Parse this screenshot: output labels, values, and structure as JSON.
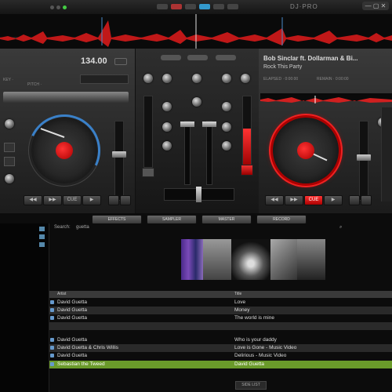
{
  "app": {
    "brand": "DJ·PRO",
    "window_controls": "— ▢ ✕"
  },
  "deckLeft": {
    "bpm": "134.00",
    "sub_label_1": "KEY ·",
    "sub_label_2": "PITCH ·",
    "buttons": [
      "◀◀",
      "▶▶",
      "CUE",
      "▶"
    ]
  },
  "deckRight": {
    "title": "Bob Sinclar ft. Dollarman & Bi...",
    "track": "Rock This Party",
    "info_1": "ELAPSED · 0:00:00",
    "info_2": "REMAIN · 0:00:00",
    "buttons": [
      "◀◀",
      "▶▶",
      "CUE",
      "▶"
    ]
  },
  "tabs": [
    "EFFECTS",
    "SAMPLER",
    "MASTER",
    "RECORD"
  ],
  "browser": {
    "search_label": "Search:",
    "search_value": "guetta",
    "columns": [
      "Artist",
      "Title"
    ],
    "rows": [
      {
        "artist": "David Guetta",
        "title": "Love"
      },
      {
        "artist": "David Guetta",
        "title": "Money"
      },
      {
        "artist": "David Guetta",
        "title": "The world is mine"
      },
      {
        "artist": "",
        "title": ""
      },
      {
        "artist": "David Guetta",
        "title": "Who is your daddy"
      },
      {
        "artist": "David Guetta & Chris Willis",
        "title": "Love is Gone - Music Video"
      },
      {
        "artist": "David Guetta",
        "title": "Delirious - Music Video"
      },
      {
        "artist": "Sebastian the Tweed",
        "title": "David Guetta"
      }
    ],
    "status_button": "SIDE LIST"
  },
  "colors": {
    "accent": "#e02020",
    "selection": "#6a9a2a"
  }
}
